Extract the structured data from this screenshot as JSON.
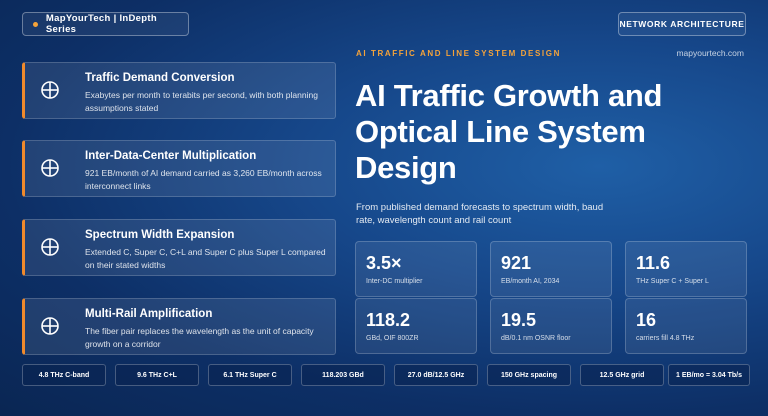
{
  "header": {
    "brand": "MapYourTech | InDepth Series",
    "category": "NETWORK ARCHITECTURE",
    "eyebrow": "AI TRAFFIC AND LINE SYSTEM DESIGN",
    "site": "mapyourtech.com"
  },
  "hero": {
    "title": "AI Traffic Growth and Optical Line System Design",
    "subtitle": "From published demand forecasts to spectrum width, baud rate, wavelength count and rail count"
  },
  "cards": [
    {
      "title": "Traffic Demand Conversion",
      "desc": "Exabytes per month to terabits per second, with both planning assumptions stated",
      "icon": "crosshair-icon"
    },
    {
      "title": "Inter-Data-Center Multiplication",
      "desc": "921 EB/month of AI demand carried as 3,260 EB/month across interconnect links",
      "icon": "crosshair-icon"
    },
    {
      "title": "Spectrum Width Expansion",
      "desc": "Extended C, Super C, C+L and Super C plus Super L compared on their stated widths",
      "icon": "crosshair-icon"
    },
    {
      "title": "Multi-Rail Amplification",
      "desc": "The fiber pair replaces the wavelength as the unit of capacity growth on a corridor",
      "icon": "crosshair-icon"
    }
  ],
  "stats": [
    {
      "value": "3.5×",
      "label": "Inter-DC multiplier"
    },
    {
      "value": "921",
      "label": "EB/month AI, 2034"
    },
    {
      "value": "11.6",
      "label": "THz Super C + Super L"
    },
    {
      "value": "118.2",
      "label": "GBd, OIF 800ZR"
    },
    {
      "value": "19.5",
      "label": "dB/0.1 nm OSNR floor"
    },
    {
      "value": "16",
      "label": "carriers fill 4.8 THz"
    }
  ],
  "chips": [
    "4.8 THz C-band",
    "9.6 THz C+L",
    "6.1 THz Super C",
    "118.203 GBd",
    "27.0 dB/12.5 GHz",
    "150 GHz spacing",
    "12.5 GHz grid",
    "1 EB/mo = 3.04 Tb/s"
  ],
  "colors": {
    "accent": "#f08a2c",
    "eyebrow": "#f5a33a",
    "background": "#16478a"
  }
}
